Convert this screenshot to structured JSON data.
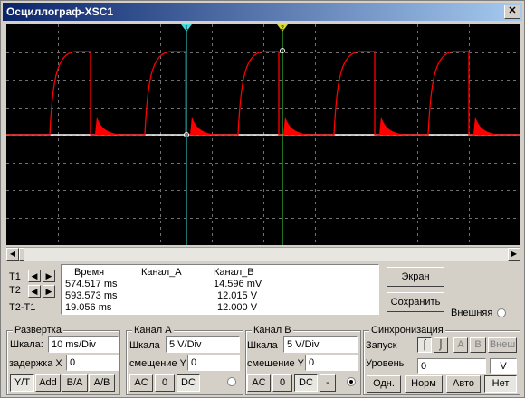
{
  "window": {
    "title": "Осциллограф-XSC1",
    "close_glyph": "✕"
  },
  "readout": {
    "headers": [
      "Время",
      "Канал_A",
      "Канал_B"
    ],
    "rows": [
      {
        "label": "T1",
        "time": "574.517 ms",
        "a": "",
        "b": "14.596 mV"
      },
      {
        "label": "T2",
        "time": "593.573 ms",
        "a": "",
        "b": "12.015 V"
      },
      {
        "label": "T2-T1",
        "time": "19.056 ms",
        "a": "",
        "b": "12.000 V"
      }
    ]
  },
  "buttons": {
    "screen": "Экран",
    "save": "Сохранить",
    "external": "Внешняя"
  },
  "timebase": {
    "title": "Развертка",
    "scale_label": "Шкала:",
    "scale_value": "10 ms/Div",
    "delay_label": "задержка X",
    "delay_value": "0",
    "modes": [
      "Y/T",
      "Add",
      "B/A",
      "A/B"
    ],
    "active_mode": "Y/T"
  },
  "channel_a": {
    "title": "Канал A",
    "scale_label": "Шкала",
    "scale_value": "5  V/Div",
    "offset_label": "смещение Y",
    "offset_value": "0",
    "coupling": [
      "AC",
      "0",
      "DC"
    ],
    "active": "DC"
  },
  "channel_b": {
    "title": "Канал B",
    "scale_label": "Шкала",
    "scale_value": "5  V/Div",
    "offset_label": "смещение Y",
    "offset_value": "0",
    "coupling": [
      "AC",
      "0",
      "DC",
      "-"
    ],
    "active": "DC"
  },
  "trigger": {
    "title": "Синхронизация",
    "edge_label": "Запуск",
    "sources": [
      "A",
      "B",
      "Внеш"
    ],
    "level_label": "Уровень",
    "level_value": "0",
    "level_unit": "V",
    "modes": [
      "Одн.",
      "Норм",
      "Авто",
      "Нет"
    ],
    "active_mode": "Нет"
  },
  "cursors": {
    "t1_color": "#40e0e0",
    "t2_color": "#d8d840",
    "t1_label": "1",
    "t2_label": "2"
  },
  "colors": {
    "trace_a": "#ffffff",
    "trace_b": "#ff0000",
    "grid": "#606060"
  }
}
